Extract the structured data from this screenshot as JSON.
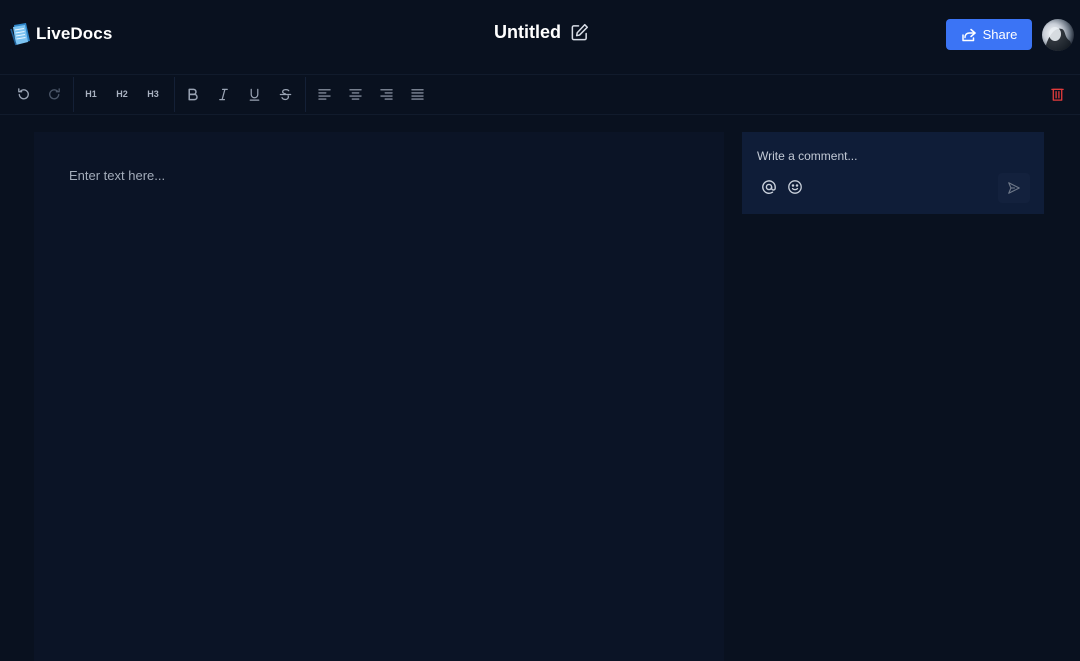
{
  "app": {
    "name": "LiveDocs"
  },
  "document": {
    "title": "Untitled"
  },
  "header": {
    "share_label": "Share"
  },
  "toolbar": {
    "heading_1": "H1",
    "heading_2": "H2",
    "heading_3": "H3",
    "icons": [
      "undo-icon",
      "redo-icon",
      "bold-icon",
      "italic-icon",
      "underline-icon",
      "strikethrough-icon",
      "align-left-icon",
      "align-center-icon",
      "align-right-icon",
      "align-justify-icon",
      "trash-icon"
    ]
  },
  "editor": {
    "placeholder": "Enter text here..."
  },
  "comments": {
    "placeholder": "Write a comment..."
  },
  "colors": {
    "background": "#09111f",
    "editor_bg": "#0b1426",
    "comment_bg": "#0f1d38",
    "accent": "#3b74f5",
    "danger": "#e23b3b"
  }
}
